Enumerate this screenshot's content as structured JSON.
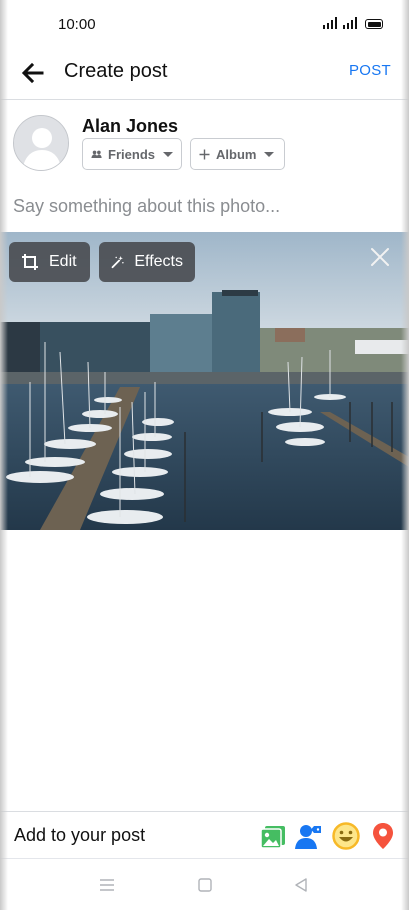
{
  "status_bar": {
    "time": "10:00"
  },
  "header": {
    "title": "Create post",
    "post_label": "POST"
  },
  "author": {
    "name": "Alan Jones",
    "audience_label": "Friends",
    "album_label": "Album"
  },
  "composer": {
    "placeholder": "Say something about this photo..."
  },
  "photo_tools": {
    "edit_label": "Edit",
    "effects_label": "Effects"
  },
  "add_to_post": {
    "label": "Add to your post",
    "icons": [
      "photo-icon",
      "tag-people-icon",
      "feeling-icon",
      "location-icon"
    ]
  },
  "colors": {
    "accent": "#1877f2",
    "photo_green": "#45bd62",
    "feeling_yellow": "#f7b928",
    "location_red": "#f02849"
  }
}
